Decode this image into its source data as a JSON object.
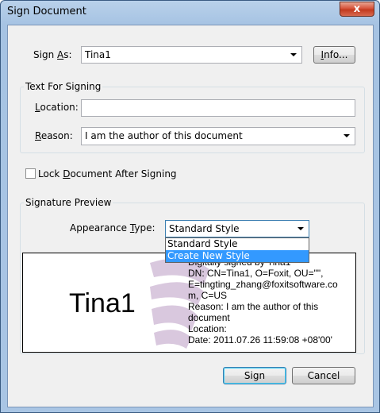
{
  "window": {
    "title": "Sign Document",
    "close_label": "x"
  },
  "sign_as": {
    "label_prefix": "Sign ",
    "label_accel": "A",
    "label_suffix": "s:",
    "value": "Tina1",
    "info_button_accel": "I",
    "info_button_rest": "nfo..."
  },
  "text_for_signing": {
    "group_title": "Text For Signing",
    "location_label_accel": "L",
    "location_label_rest": "ocation:",
    "location_value": "",
    "reason_label_accel": "R",
    "reason_label_rest": "eason:",
    "reason_value": "I am the author of this document"
  },
  "lock_document": {
    "label_prefix": "Lock ",
    "label_accel": "D",
    "label_suffix": "ocument After Signing",
    "checked": false
  },
  "signature_preview": {
    "group_title": "Signature Preview",
    "appearance_label_prefix": "Appearance ",
    "appearance_label_accel": "T",
    "appearance_label_suffix": "ype:",
    "appearance_value": "Standard Style",
    "appearance_options": [
      "Standard Style",
      "Create New Style"
    ],
    "highlighted_option": "Create New Style",
    "signer_name": "Tina1",
    "details": [
      "Digitally signed by Tina1",
      "DN: CN=Tina1, O=Foxit, OU=\"\",",
      "E=tingting_zhang@foxitsoftware.co",
      "m, C=US",
      "Reason: I am the author of this",
      "document",
      "Location:",
      "Date: 2011.07.26 11:59:08 +08'00'"
    ]
  },
  "buttons": {
    "sign": "Sign",
    "cancel": "Cancel"
  },
  "colors": {
    "title_gradient_top": "#b9d1ea",
    "client_bg": "#f0f0f0",
    "selection": "#3399ff",
    "watermark": "#d9c8de"
  }
}
